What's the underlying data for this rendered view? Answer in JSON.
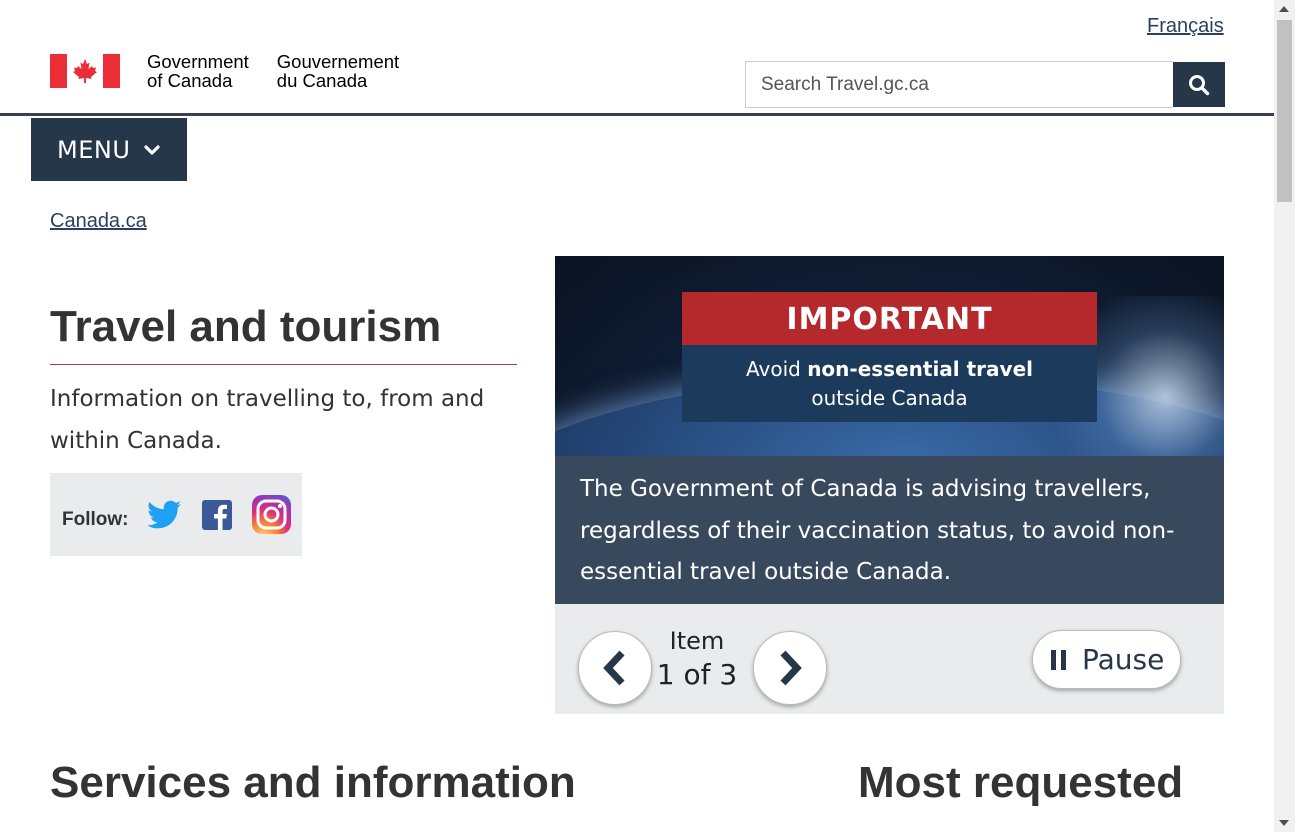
{
  "header": {
    "lang_link": "Français",
    "signature_en_line1": "Government",
    "signature_en_line2": "of Canada",
    "signature_fr_line1": "Gouvernement",
    "signature_fr_line2": "du Canada",
    "search_placeholder": "Search Travel.gc.ca",
    "search_icon": "search-icon",
    "menu_label": "MENU",
    "menu_icon": "chevron-down-icon",
    "brand_red": "#eb2d37",
    "nav_dark": "#26374a"
  },
  "breadcrumb": {
    "items": [
      "Canada.ca"
    ]
  },
  "main": {
    "title": "Travel and tourism",
    "intro": "Information on travelling to, from and within Canada.",
    "follow_label": "Follow:",
    "social_icons": [
      "twitter-icon",
      "facebook-icon",
      "instagram-icon"
    ]
  },
  "carousel": {
    "banner_heading": "IMPORTANT",
    "banner_line1_normal": "Avoid ",
    "banner_line1_bold": "non-essential travel",
    "banner_line2": "outside Canada",
    "caption": "The Government of Canada is advising travellers, regardless of their vaccination status, to avoid non-essential travel outside Canada.",
    "item_word": "Item",
    "item_position": "1 of 3",
    "pause_label": "Pause",
    "caption_bg": "#38495e",
    "banner_red": "#b5282c"
  },
  "sections": {
    "services_heading": "Services and information",
    "most_requested_heading": "Most requested"
  }
}
